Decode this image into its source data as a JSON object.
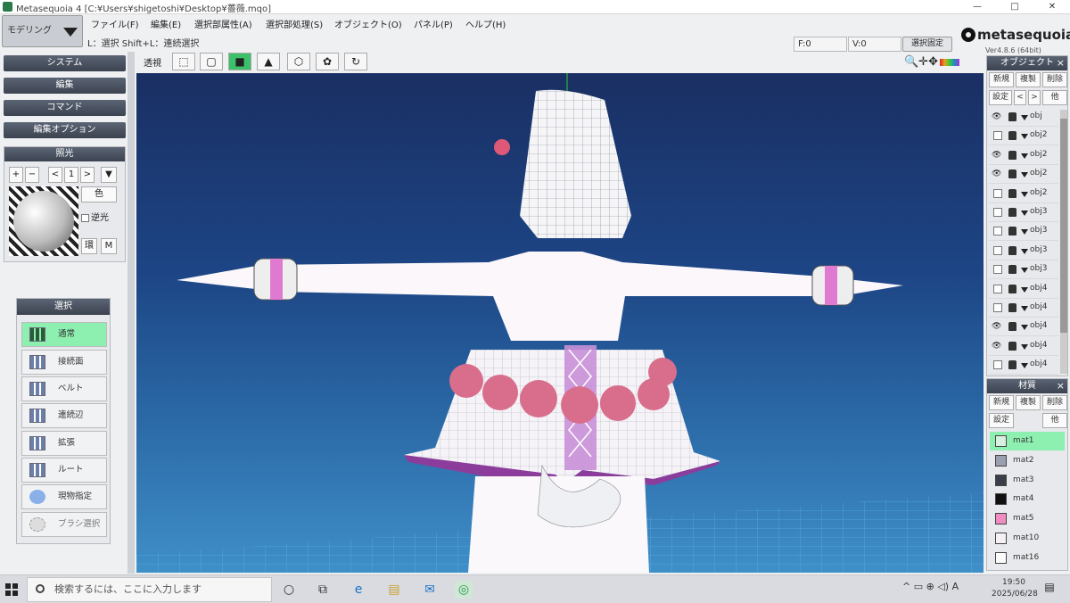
{
  "window": {
    "title": "Metasequoia 4 [C:¥Users¥shigetoshi¥Desktop¥薔薇.mqo]",
    "min": "—",
    "max": "□",
    "close": "✕"
  },
  "mode": {
    "label": "モデリング"
  },
  "menu": [
    "ファイル(F)",
    "編集(E)",
    "選択部属性(A)",
    "選択部処理(S)",
    "オブジェクト(O)",
    "パネル(P)",
    "ヘルプ(H)"
  ],
  "hint": "L：選択 Shift+L：連続選択",
  "status": {
    "f": "F:0",
    "v": "V:0",
    "fix": "選択固定"
  },
  "logo": {
    "text": "metasequoia4",
    "version": "Ver4.8.6 (64bit)"
  },
  "viewtoolbar": {
    "label": "透視",
    "icons": [
      "⬚",
      "▢",
      "■",
      "▲",
      "⬡",
      "✿",
      "↻"
    ]
  },
  "viewright": "🔍✛✥",
  "leftbuttons": [
    "システム",
    "編集",
    "コマンド",
    "編集オプション"
  ],
  "light": {
    "title": "照光",
    "plus": "+",
    "minus": "−",
    "prev": "<",
    "num": "1",
    "next": ">",
    "menu": "▼",
    "color": "色",
    "backlight": "逆光",
    "env": "環",
    "m": "M"
  },
  "select": {
    "title": "選択",
    "items": [
      "通常",
      "接続面",
      "ベルト",
      "連続辺",
      "拡張",
      "ルート",
      "現物指定",
      "ブラシ選択"
    ]
  },
  "objpanel": {
    "title": "オブジェクト",
    "close": "×",
    "btn_new": "新規",
    "btn_copy": "複製",
    "btn_del": "削除",
    "btn_set": "設定",
    "btn_prev": "<",
    "btn_next": ">",
    "btn_other": "他",
    "rows": [
      {
        "name": "obj",
        "eye": true
      },
      {
        "name": "obj2",
        "eye": false
      },
      {
        "name": "obj2",
        "eye": true
      },
      {
        "name": "obj2",
        "eye": true
      },
      {
        "name": "obj2",
        "eye": false
      },
      {
        "name": "obj3",
        "eye": false
      },
      {
        "name": "obj3",
        "eye": false
      },
      {
        "name": "obj3",
        "eye": false
      },
      {
        "name": "obj3",
        "eye": false
      },
      {
        "name": "obj4",
        "eye": false
      },
      {
        "name": "obj4",
        "eye": false
      },
      {
        "name": "obj4",
        "eye": true
      },
      {
        "name": "obj4",
        "eye": true
      },
      {
        "name": "obj4",
        "eye": false
      }
    ]
  },
  "matpanel": {
    "title": "材質",
    "close": "×",
    "btn_new": "新規",
    "btn_copy": "複製",
    "btn_del": "削除",
    "btn_set": "設定",
    "btn_other": "他",
    "rows": [
      {
        "name": "mat1",
        "color": "#d8f0e0"
      },
      {
        "name": "mat2",
        "color": "#9aa0ae"
      },
      {
        "name": "mat3",
        "color": "#3a3e48"
      },
      {
        "name": "mat4",
        "color": "#111111"
      },
      {
        "name": "mat5",
        "color": "#f08cc0"
      },
      {
        "name": "mat10",
        "color": "#f5f0f4"
      },
      {
        "name": "mat16",
        "color": "#fbfbfb"
      }
    ]
  },
  "taskbar": {
    "search": "検索するには、ここに入力します",
    "time": "19:50",
    "date": "2025/06/28",
    "tray": "^ ▭ ⊕ ◁) A"
  }
}
